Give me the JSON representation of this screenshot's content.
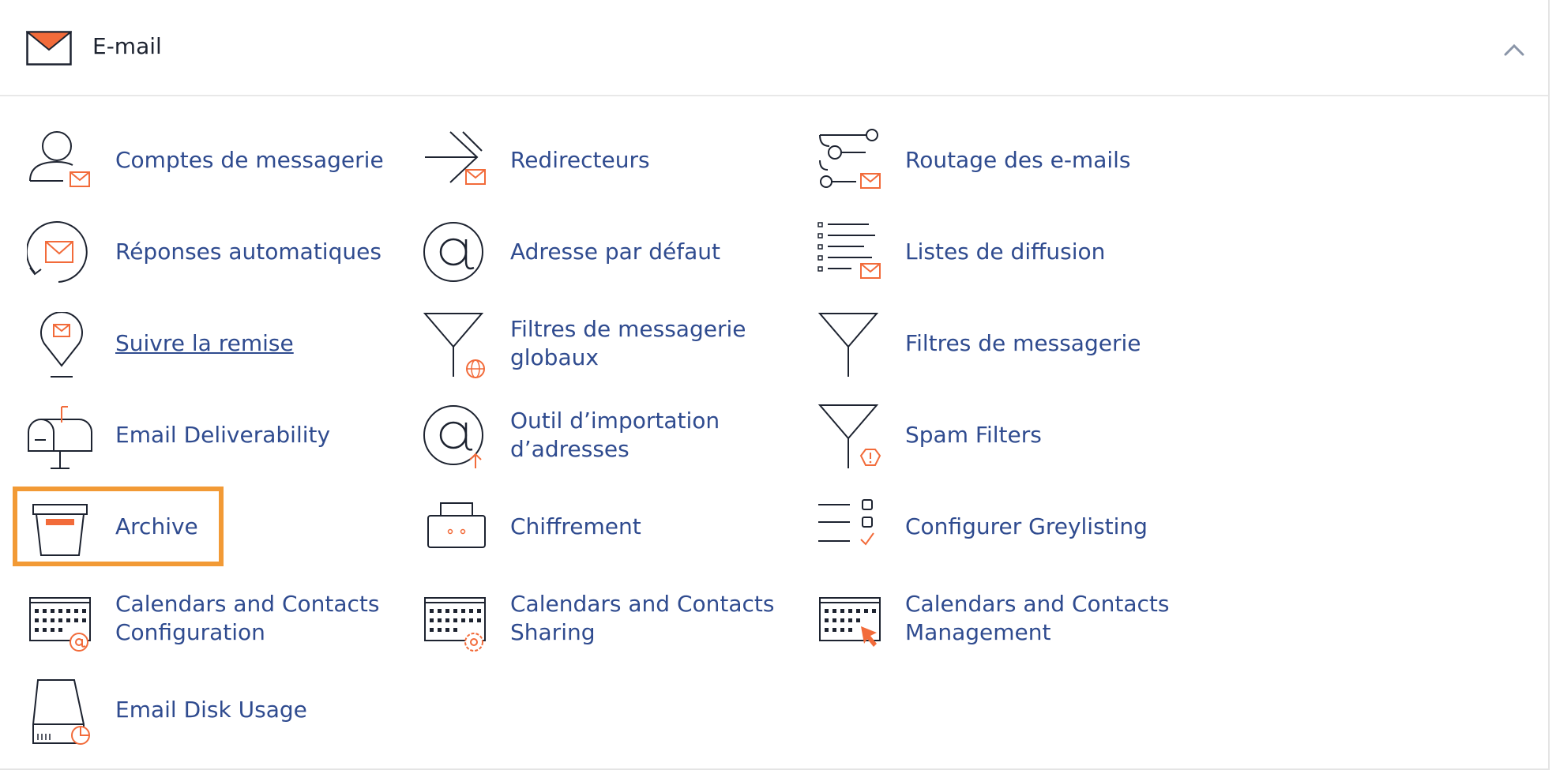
{
  "header": {
    "title": "E-mail",
    "collapse_icon": "chevron-up-icon"
  },
  "accent_color": "#f26b3a",
  "link_color": "#2f4b8f",
  "highlight_color": "#f29a35",
  "items": {
    "email_accounts": {
      "label": "Comptes de messagerie",
      "icon": "user-mail-icon"
    },
    "forwarders": {
      "label": "Redirecteurs",
      "icon": "forward-arrow-icon"
    },
    "email_routing": {
      "label": "Routage des e-mails",
      "icon": "routing-icon"
    },
    "autoresponders": {
      "label": "Réponses automatiques",
      "icon": "autoresponder-icon"
    },
    "default_address": {
      "label": "Adresse par défaut",
      "icon": "at-sign-icon"
    },
    "mailing_lists": {
      "label": "Listes de diffusion",
      "icon": "list-mail-icon"
    },
    "track_delivery": {
      "label": "Suivre la remise",
      "icon": "location-pin-mail-icon"
    },
    "global_filters": {
      "label": "Filtres de messagerie globaux",
      "icon": "filter-globe-icon"
    },
    "email_filters": {
      "label": "Filtres de messagerie",
      "icon": "filter-icon"
    },
    "deliverability": {
      "label": "Email Deliverability",
      "icon": "mailbox-icon"
    },
    "address_importer": {
      "label": "Outil d’importation d’adresses",
      "icon": "at-upload-icon"
    },
    "spam_filters": {
      "label": "Spam Filters",
      "icon": "filter-alert-icon"
    },
    "archive": {
      "label": "Archive",
      "icon": "archive-box-icon"
    },
    "encryption": {
      "label": "Chiffrement",
      "icon": "padlock-icon"
    },
    "greylisting": {
      "label": "Configurer Greylisting",
      "icon": "checklist-icon"
    },
    "cal_config": {
      "label": "Calendars and Contacts Configuration",
      "icon": "calendar-at-icon"
    },
    "cal_sharing": {
      "label": "Calendars and Contacts Sharing",
      "icon": "calendar-gear-icon"
    },
    "cal_management": {
      "label": "Calendars and Contacts Management",
      "icon": "calendar-cursor-icon"
    },
    "disk_usage": {
      "label": "Email Disk Usage",
      "icon": "disk-pie-icon"
    }
  }
}
